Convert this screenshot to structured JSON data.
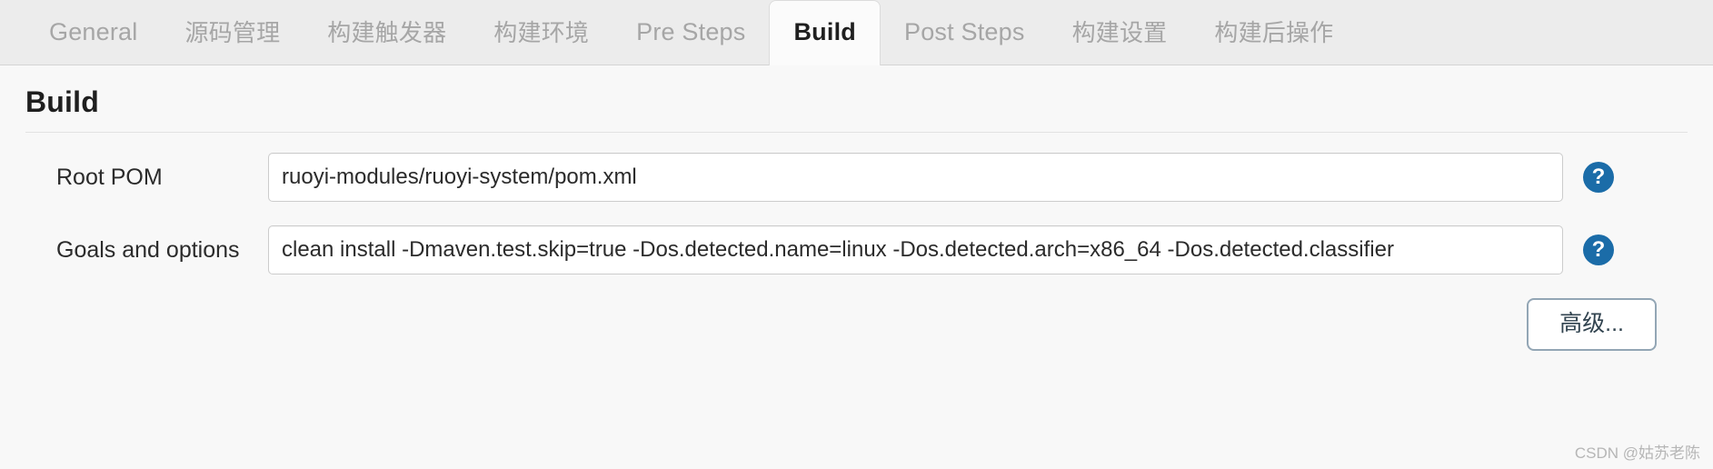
{
  "tabs": [
    {
      "label": "General",
      "active": false,
      "cjk": false
    },
    {
      "label": "源码管理",
      "active": false,
      "cjk": true
    },
    {
      "label": "构建触发器",
      "active": false,
      "cjk": true
    },
    {
      "label": "构建环境",
      "active": false,
      "cjk": true
    },
    {
      "label": "Pre Steps",
      "active": false,
      "cjk": false
    },
    {
      "label": "Build",
      "active": true,
      "cjk": false
    },
    {
      "label": "Post Steps",
      "active": false,
      "cjk": false
    },
    {
      "label": "构建设置",
      "active": false,
      "cjk": true
    },
    {
      "label": "构建后操作",
      "active": false,
      "cjk": true
    }
  ],
  "section": {
    "title": "Build"
  },
  "fields": [
    {
      "label": "Root POM",
      "value": "ruoyi-modules/ruoyi-system/pom.xml",
      "help": "?"
    },
    {
      "label": "Goals and options",
      "value": "clean install -Dmaven.test.skip=true -Dos.detected.name=linux -Dos.detected.arch=x86_64 -Dos.detected.classifier",
      "help": "?"
    }
  ],
  "actions": {
    "advanced_label": "高级..."
  },
  "watermark": {
    "text": "CSDN @姑苏老陈"
  },
  "colors": {
    "help_icon_blue": "#1b6ca8",
    "tabbar_bg": "#ececec",
    "content_bg": "#f8f8f8",
    "active_tab_bg": "#fbfbfb"
  }
}
